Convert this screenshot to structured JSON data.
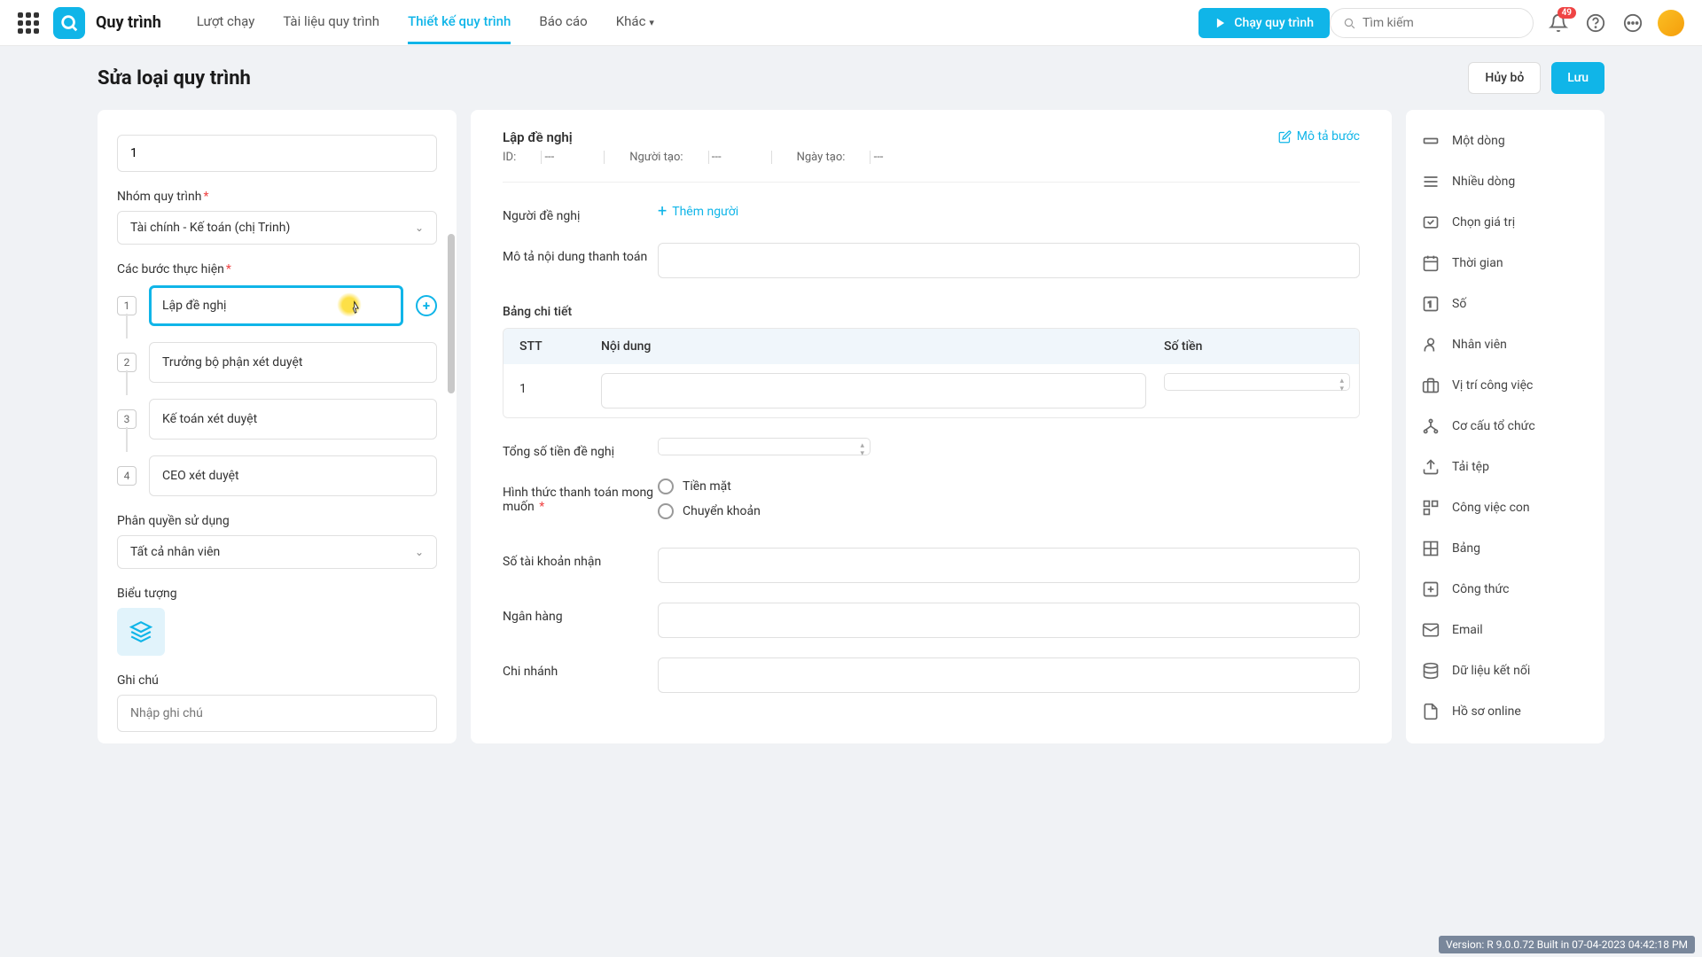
{
  "topbar": {
    "app_title": "Quy trình",
    "tabs": [
      "Lượt chạy",
      "Tài liệu quy trình",
      "Thiết kế quy trình",
      "Báo cáo",
      "Khác"
    ],
    "active_tab_index": 2,
    "run_button": "Chạy quy trình",
    "search_placeholder": "Tìm kiếm",
    "notification_count": "49"
  },
  "page": {
    "title": "Sửa loại quy trình",
    "cancel": "Hủy bỏ",
    "save": "Lưu"
  },
  "left": {
    "number_value": "1",
    "group_label": "Nhóm quy trình",
    "group_value": "Tài chính - Kế toán (chị Trinh)",
    "steps_label": "Các bước thực hiện",
    "steps": [
      "Lập đề nghị",
      "Trưởng bộ phận xét duyệt",
      "Kế toán xét duyệt",
      "CEO xét duyệt"
    ],
    "selected_step_index": 0,
    "perm_label": "Phân quyền sử dụng",
    "perm_value": "Tất cả nhân viên",
    "icon_label": "Biểu tượng",
    "note_label": "Ghi chú",
    "note_placeholder": "Nhập ghi chú"
  },
  "center": {
    "title": "Lập đề nghị",
    "desc_link": "Mô tả bước",
    "meta": {
      "id_label": "ID:",
      "id_val": "---",
      "creator_label": "Người tạo:",
      "creator_val": "---",
      "date_label": "Ngày tạo:",
      "date_val": "---"
    },
    "fields": {
      "requester": "Người đề nghị",
      "add_person": "Thêm người",
      "desc": "Mô tả nội dung thanh toán",
      "detail_table": "Bảng chi tiết",
      "total": "Tổng số tiền đề nghị",
      "payment": "Hình thức thanh toán mong muốn",
      "account": "Số tài khoản nhận",
      "bank": "Ngân hàng",
      "branch": "Chi nhánh"
    },
    "table": {
      "cols": [
        "STT",
        "Nội dung",
        "Số tiền"
      ],
      "row1": "1"
    },
    "payment_options": [
      "Tiền mặt",
      "Chuyển khoản"
    ]
  },
  "right": {
    "items": [
      "Một dòng",
      "Nhiều dòng",
      "Chọn giá trị",
      "Thời gian",
      "Số",
      "Nhân viên",
      "Vị trí công việc",
      "Cơ cấu tổ chức",
      "Tải tệp",
      "Công việc con",
      "Bảng",
      "Công thức",
      "Email",
      "Dữ liệu kết nối",
      "Hồ sơ online"
    ]
  },
  "version": "Version: R 9.0.0.72 Built in 07-04-2023 04:42:18 PM"
}
